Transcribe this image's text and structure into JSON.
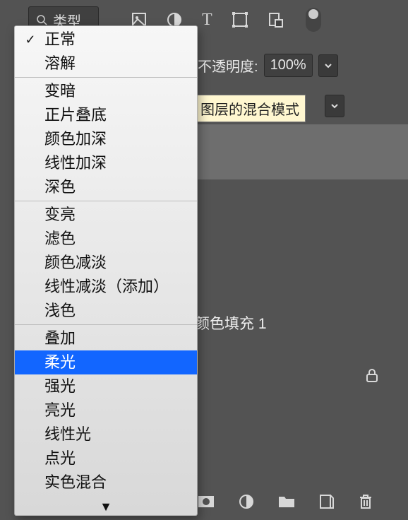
{
  "toolbar": {
    "type_label": "类型",
    "opacity_label": "不透明度:",
    "opacity_value": "100%"
  },
  "tooltip": "图层的混合模式",
  "layer_name": "颜色填充 1",
  "blend_modes": {
    "selected": "正常",
    "highlighted": "柔光",
    "groups": [
      [
        "正常",
        "溶解"
      ],
      [
        "变暗",
        "正片叠底",
        "颜色加深",
        "线性加深",
        "深色"
      ],
      [
        "变亮",
        "滤色",
        "颜色减淡",
        "线性减淡（添加）",
        "浅色"
      ],
      [
        "叠加",
        "柔光",
        "强光",
        "亮光",
        "线性光",
        "点光",
        "实色混合"
      ]
    ]
  }
}
